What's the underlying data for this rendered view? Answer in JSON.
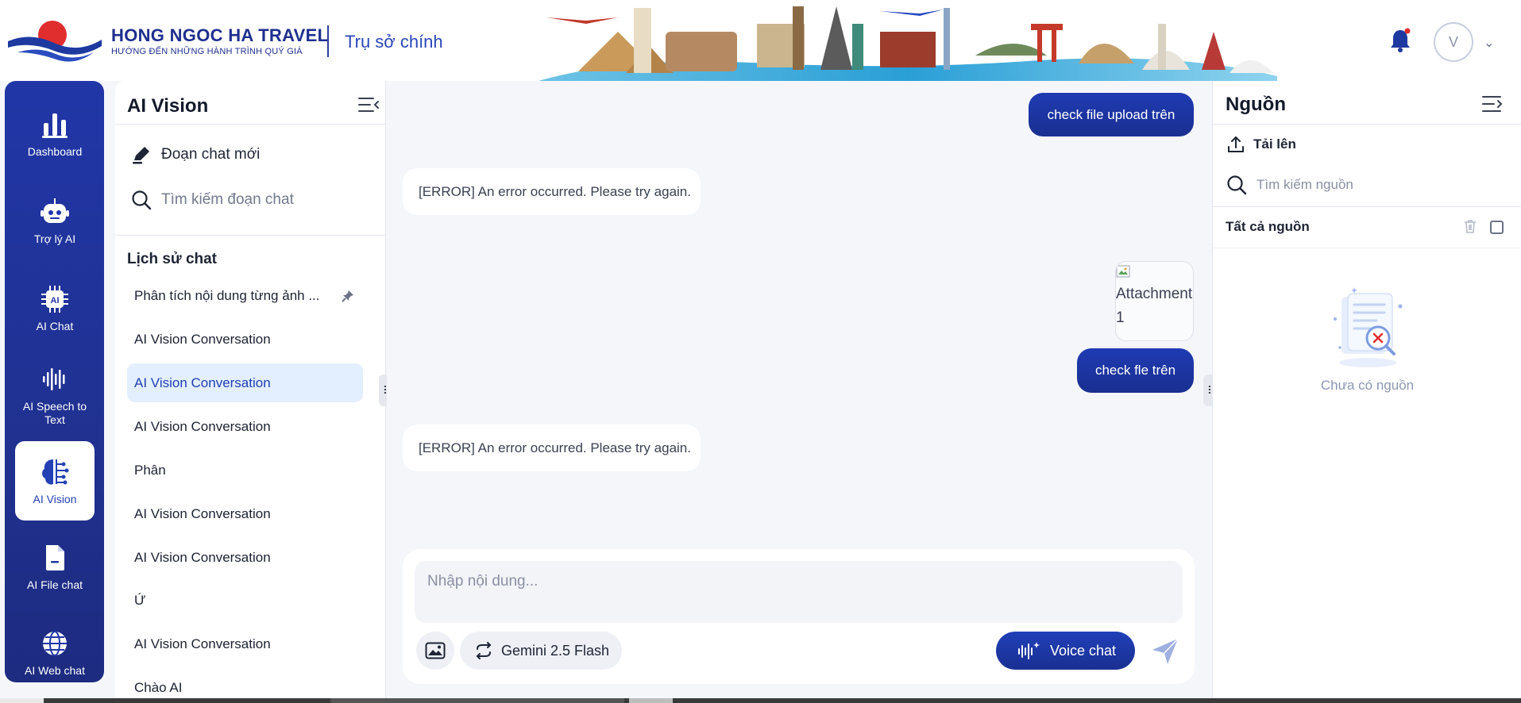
{
  "header": {
    "brand_name": "HONG NGOC HA TRAVEL",
    "brand_slogan": "HƯỚNG ĐẾN NHỮNG HÀNH TRÌNH QUÝ GIÁ",
    "site": "Trụ sở chính",
    "avatar_initial": "V",
    "colors": {
      "brand": "#1e2f8e",
      "accent_red": "#e02d2d"
    }
  },
  "leftnav": {
    "items": [
      {
        "label": "Dashboard",
        "icon": "bar-chart-icon"
      },
      {
        "label": "Trợ lý AI",
        "icon": "robot-icon"
      },
      {
        "label": "AI Chat",
        "icon": "ai-chip-icon"
      },
      {
        "label": "AI Speech to Text",
        "icon": "waveform-icon"
      },
      {
        "label": "AI Vision",
        "icon": "brain-icon",
        "active": true
      },
      {
        "label": "AI File chat",
        "icon": "file-icon"
      },
      {
        "label": "AI Web chat",
        "icon": "globe-icon"
      }
    ]
  },
  "listpanel": {
    "title": "AI Vision",
    "new_chat": "Đoạn chat mới",
    "search_placeholder": "Tìm kiếm đoạn chat",
    "history_title": "Lịch sử chat",
    "history": [
      {
        "label": "Phân tích nội dung từng ảnh ...",
        "pinned": true
      },
      {
        "label": "AI Vision Conversation"
      },
      {
        "label": "AI Vision Conversation",
        "active": true
      },
      {
        "label": "AI Vision Conversation"
      },
      {
        "label": "Phân"
      },
      {
        "label": "AI Vision Conversation"
      },
      {
        "label": "AI Vision Conversation"
      },
      {
        "label": "Ứ"
      },
      {
        "label": "AI Vision Conversation"
      },
      {
        "label": "Chào AI"
      }
    ]
  },
  "chat": {
    "messages": [
      {
        "role": "user",
        "text": "check file upload trên"
      },
      {
        "role": "bot",
        "text": "[ERROR] An error occurred. Please try again."
      },
      {
        "role": "attachment",
        "alt": "Attachment 1"
      },
      {
        "role": "user",
        "text": "check fle trên"
      },
      {
        "role": "bot",
        "text": "[ERROR] An error occurred. Please try again."
      }
    ],
    "composer": {
      "placeholder": "Nhập nội dung...",
      "model": "Gemini 2.5 Flash",
      "voice_label": "Voice chat"
    }
  },
  "sources": {
    "title": "Nguồn",
    "upload": "Tải lên",
    "search_placeholder": "Tìm kiếm nguồn",
    "all": "Tất cả nguồn",
    "empty": "Chưa có nguồn"
  }
}
